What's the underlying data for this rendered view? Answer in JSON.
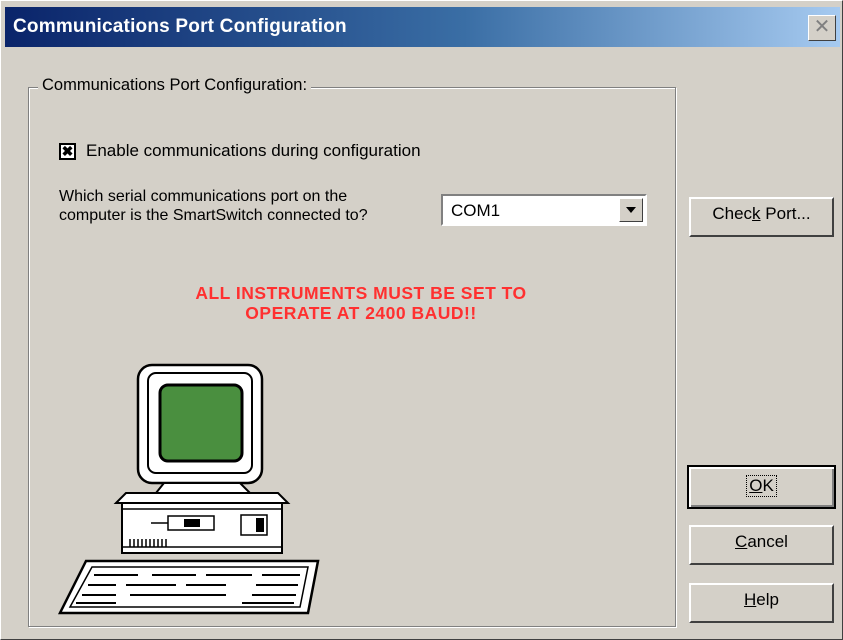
{
  "window": {
    "title": "Communications Port Configuration",
    "close_glyph": "✕"
  },
  "group": {
    "label": "Communications Port Configuration:"
  },
  "enable_comms": {
    "checked": true,
    "label": "Enable communications during configuration"
  },
  "port_question": {
    "line1": "Which serial communications port on the",
    "line2": "computer is the SmartSwitch connected to?"
  },
  "port_select": {
    "value": "COM1"
  },
  "warning": {
    "line1": "ALL INSTRUMENTS MUST BE SET TO",
    "line2": "OPERATE AT 2400 BAUD!!",
    "color": "#ff3030"
  },
  "buttons": {
    "check_port": {
      "pre": "Chec",
      "accel": "k",
      "post": " Port..."
    },
    "ok": {
      "accel": "O",
      "post": "K"
    },
    "cancel": {
      "accel": "C",
      "post": "ancel"
    },
    "help": {
      "accel": "H",
      "post": "elp"
    }
  },
  "illustration": {
    "icon": "desktop-computer-icon",
    "screen_color": "#4a8f3f"
  }
}
